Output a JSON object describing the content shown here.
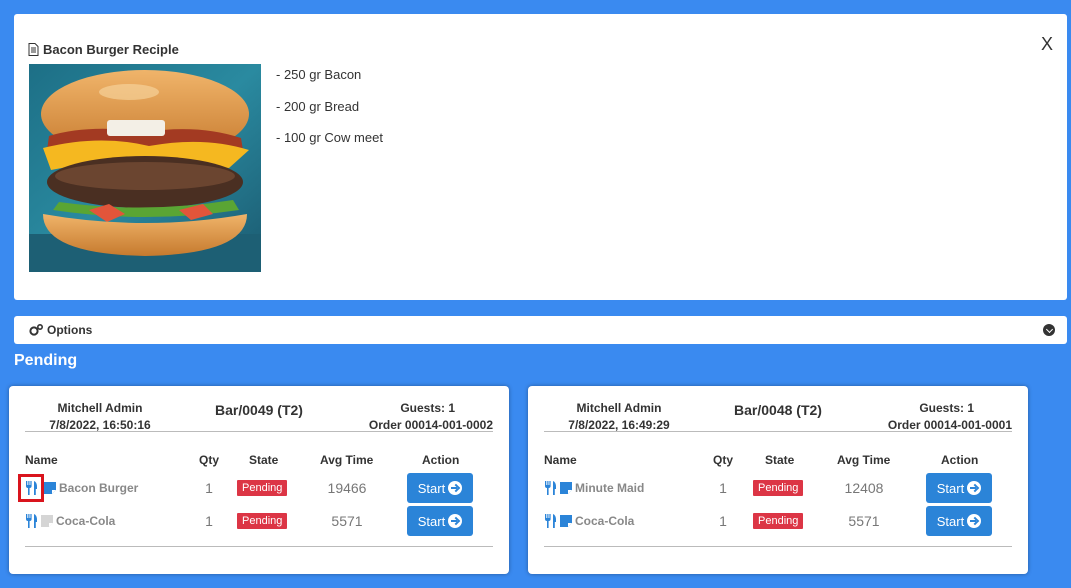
{
  "recipe": {
    "title": "Bacon Burger Reciple",
    "close_label": "X",
    "ingredients": [
      "- 250 gr Bacon",
      "- 200 gr Bread",
      "- 100 gr Cow meet"
    ]
  },
  "options": {
    "label": "Options"
  },
  "pending": {
    "heading": "Pending"
  },
  "columns": {
    "name": "Name",
    "qty": "Qty",
    "state": "State",
    "avg": "Avg Time",
    "action": "Action"
  },
  "orders": [
    {
      "user": "Mitchell Admin",
      "datetime": "7/8/2022, 16:50:16",
      "ref": "Bar/0049 (T2)",
      "guests": "Guests: 1",
      "order_no": "Order 00014-001-0002",
      "items": [
        {
          "name": "Bacon Burger",
          "qty": "1",
          "state": "Pending",
          "avg": "19466",
          "action": "Start",
          "note_active": true
        },
        {
          "name": "Coca-Cola",
          "qty": "1",
          "state": "Pending",
          "avg": "5571",
          "action": "Start",
          "note_active": false
        }
      ]
    },
    {
      "user": "Mitchell Admin",
      "datetime": "7/8/2022, 16:49:29",
      "ref": "Bar/0048 (T2)",
      "guests": "Guests: 1",
      "order_no": "Order 00014-001-0001",
      "items": [
        {
          "name": "Minute Maid",
          "qty": "1",
          "state": "Pending",
          "avg": "12408",
          "action": "Start",
          "note_active": true
        },
        {
          "name": "Coca-Cola",
          "qty": "1",
          "state": "Pending",
          "avg": "5571",
          "action": "Start",
          "note_active": true
        }
      ]
    }
  ],
  "colors": {
    "background": "#3a8af0",
    "badge": "#dc3545",
    "button": "#2b84d8",
    "icon": "#2b84d8",
    "highlight": "#d9141d"
  }
}
